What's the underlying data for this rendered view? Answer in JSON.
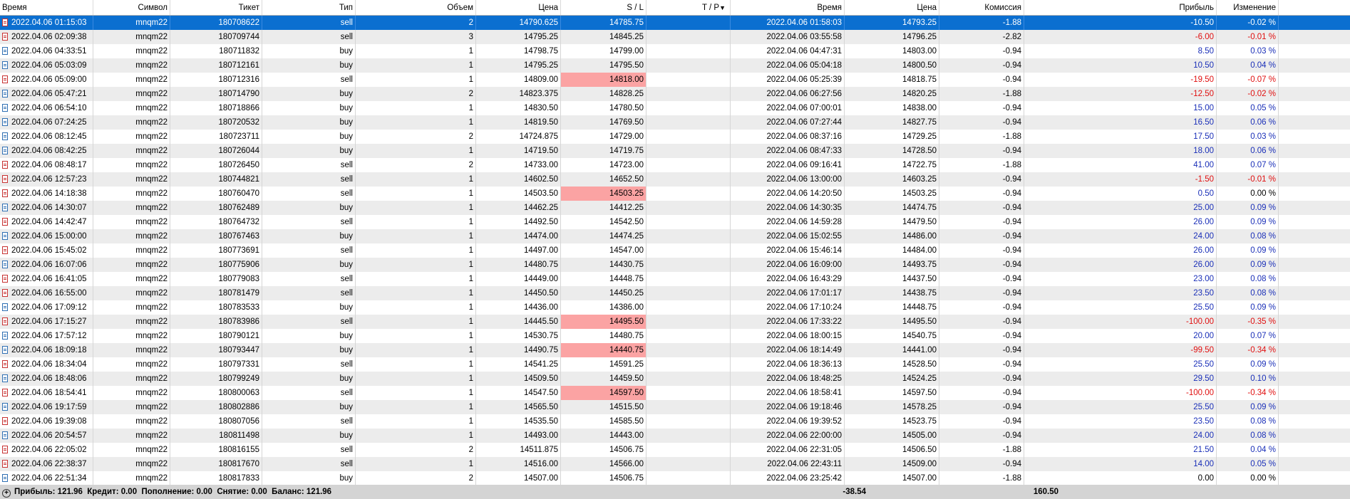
{
  "columns": [
    "Время",
    "Символ",
    "Тикет",
    "Тип",
    "Объем",
    "Цена",
    "S / L",
    "T / P",
    "Время",
    "Цена",
    "Комиссия",
    "Прибыль",
    "Изменение"
  ],
  "sort_arrow": "▼",
  "selected_row": 0,
  "rows": [
    {
      "t1": "2022.04.06 01:15:03",
      "sym": "mnqm22",
      "ticket": "180708622",
      "type": "sell",
      "vol": "2",
      "price": "14790.625",
      "sl": "14785.75",
      "sl_hit": false,
      "tp": "",
      "t2": "2022.04.06 01:58:03",
      "price2": "14793.25",
      "comm": "-1.88",
      "profit": "-10.50",
      "change": "-0.02 %"
    },
    {
      "t1": "2022.04.06 02:09:38",
      "sym": "mnqm22",
      "ticket": "180709744",
      "type": "sell",
      "vol": "3",
      "price": "14795.25",
      "sl": "14845.25",
      "sl_hit": false,
      "tp": "",
      "t2": "2022.04.06 03:55:58",
      "price2": "14796.25",
      "comm": "-2.82",
      "profit": "-6.00",
      "change": "-0.01 %"
    },
    {
      "t1": "2022.04.06 04:33:51",
      "sym": "mnqm22",
      "ticket": "180711832",
      "type": "buy",
      "vol": "1",
      "price": "14798.75",
      "sl": "14799.00",
      "sl_hit": false,
      "tp": "",
      "t2": "2022.04.06 04:47:31",
      "price2": "14803.00",
      "comm": "-0.94",
      "profit": "8.50",
      "change": "0.03 %"
    },
    {
      "t1": "2022.04.06 05:03:09",
      "sym": "mnqm22",
      "ticket": "180712161",
      "type": "buy",
      "vol": "1",
      "price": "14795.25",
      "sl": "14795.50",
      "sl_hit": false,
      "tp": "",
      "t2": "2022.04.06 05:04:18",
      "price2": "14800.50",
      "comm": "-0.94",
      "profit": "10.50",
      "change": "0.04 %"
    },
    {
      "t1": "2022.04.06 05:09:00",
      "sym": "mnqm22",
      "ticket": "180712316",
      "type": "sell",
      "vol": "1",
      "price": "14809.00",
      "sl": "14818.00",
      "sl_hit": true,
      "tp": "",
      "t2": "2022.04.06 05:25:39",
      "price2": "14818.75",
      "comm": "-0.94",
      "profit": "-19.50",
      "change": "-0.07 %"
    },
    {
      "t1": "2022.04.06 05:47:21",
      "sym": "mnqm22",
      "ticket": "180714790",
      "type": "buy",
      "vol": "2",
      "price": "14823.375",
      "sl": "14828.25",
      "sl_hit": false,
      "tp": "",
      "t2": "2022.04.06 06:27:56",
      "price2": "14820.25",
      "comm": "-1.88",
      "profit": "-12.50",
      "change": "-0.02 %"
    },
    {
      "t1": "2022.04.06 06:54:10",
      "sym": "mnqm22",
      "ticket": "180718866",
      "type": "buy",
      "vol": "1",
      "price": "14830.50",
      "sl": "14780.50",
      "sl_hit": false,
      "tp": "",
      "t2": "2022.04.06 07:00:01",
      "price2": "14838.00",
      "comm": "-0.94",
      "profit": "15.00",
      "change": "0.05 %"
    },
    {
      "t1": "2022.04.06 07:24:25",
      "sym": "mnqm22",
      "ticket": "180720532",
      "type": "buy",
      "vol": "1",
      "price": "14819.50",
      "sl": "14769.50",
      "sl_hit": false,
      "tp": "",
      "t2": "2022.04.06 07:27:44",
      "price2": "14827.75",
      "comm": "-0.94",
      "profit": "16.50",
      "change": "0.06 %"
    },
    {
      "t1": "2022.04.06 08:12:45",
      "sym": "mnqm22",
      "ticket": "180723711",
      "type": "buy",
      "vol": "2",
      "price": "14724.875",
      "sl": "14729.00",
      "sl_hit": false,
      "tp": "",
      "t2": "2022.04.06 08:37:16",
      "price2": "14729.25",
      "comm": "-1.88",
      "profit": "17.50",
      "change": "0.03 %"
    },
    {
      "t1": "2022.04.06 08:42:25",
      "sym": "mnqm22",
      "ticket": "180726044",
      "type": "buy",
      "vol": "1",
      "price": "14719.50",
      "sl": "14719.75",
      "sl_hit": false,
      "tp": "",
      "t2": "2022.04.06 08:47:33",
      "price2": "14728.50",
      "comm": "-0.94",
      "profit": "18.00",
      "change": "0.06 %"
    },
    {
      "t1": "2022.04.06 08:48:17",
      "sym": "mnqm22",
      "ticket": "180726450",
      "type": "sell",
      "vol": "2",
      "price": "14733.00",
      "sl": "14723.00",
      "sl_hit": false,
      "tp": "",
      "t2": "2022.04.06 09:16:41",
      "price2": "14722.75",
      "comm": "-1.88",
      "profit": "41.00",
      "change": "0.07 %"
    },
    {
      "t1": "2022.04.06 12:57:23",
      "sym": "mnqm22",
      "ticket": "180744821",
      "type": "sell",
      "vol": "1",
      "price": "14602.50",
      "sl": "14652.50",
      "sl_hit": false,
      "tp": "",
      "t2": "2022.04.06 13:00:00",
      "price2": "14603.25",
      "comm": "-0.94",
      "profit": "-1.50",
      "change": "-0.01 %"
    },
    {
      "t1": "2022.04.06 14:18:38",
      "sym": "mnqm22",
      "ticket": "180760470",
      "type": "sell",
      "vol": "1",
      "price": "14503.50",
      "sl": "14503.25",
      "sl_hit": true,
      "tp": "",
      "t2": "2022.04.06 14:20:50",
      "price2": "14503.25",
      "comm": "-0.94",
      "profit": "0.50",
      "change": "0.00 %"
    },
    {
      "t1": "2022.04.06 14:30:07",
      "sym": "mnqm22",
      "ticket": "180762489",
      "type": "buy",
      "vol": "1",
      "price": "14462.25",
      "sl": "14412.25",
      "sl_hit": false,
      "tp": "",
      "t2": "2022.04.06 14:30:35",
      "price2": "14474.75",
      "comm": "-0.94",
      "profit": "25.00",
      "change": "0.09 %"
    },
    {
      "t1": "2022.04.06 14:42:47",
      "sym": "mnqm22",
      "ticket": "180764732",
      "type": "sell",
      "vol": "1",
      "price": "14492.50",
      "sl": "14542.50",
      "sl_hit": false,
      "tp": "",
      "t2": "2022.04.06 14:59:28",
      "price2": "14479.50",
      "comm": "-0.94",
      "profit": "26.00",
      "change": "0.09 %"
    },
    {
      "t1": "2022.04.06 15:00:00",
      "sym": "mnqm22",
      "ticket": "180767463",
      "type": "buy",
      "vol": "1",
      "price": "14474.00",
      "sl": "14474.25",
      "sl_hit": false,
      "tp": "",
      "t2": "2022.04.06 15:02:55",
      "price2": "14486.00",
      "comm": "-0.94",
      "profit": "24.00",
      "change": "0.08 %"
    },
    {
      "t1": "2022.04.06 15:45:02",
      "sym": "mnqm22",
      "ticket": "180773691",
      "type": "sell",
      "vol": "1",
      "price": "14497.00",
      "sl": "14547.00",
      "sl_hit": false,
      "tp": "",
      "t2": "2022.04.06 15:46:14",
      "price2": "14484.00",
      "comm": "-0.94",
      "profit": "26.00",
      "change": "0.09 %"
    },
    {
      "t1": "2022.04.06 16:07:06",
      "sym": "mnqm22",
      "ticket": "180775906",
      "type": "buy",
      "vol": "1",
      "price": "14480.75",
      "sl": "14430.75",
      "sl_hit": false,
      "tp": "",
      "t2": "2022.04.06 16:09:00",
      "price2": "14493.75",
      "comm": "-0.94",
      "profit": "26.00",
      "change": "0.09 %"
    },
    {
      "t1": "2022.04.06 16:41:05",
      "sym": "mnqm22",
      "ticket": "180779083",
      "type": "sell",
      "vol": "1",
      "price": "14449.00",
      "sl": "14448.75",
      "sl_hit": false,
      "tp": "",
      "t2": "2022.04.06 16:43:29",
      "price2": "14437.50",
      "comm": "-0.94",
      "profit": "23.00",
      "change": "0.08 %"
    },
    {
      "t1": "2022.04.06 16:55:00",
      "sym": "mnqm22",
      "ticket": "180781479",
      "type": "sell",
      "vol": "1",
      "price": "14450.50",
      "sl": "14450.25",
      "sl_hit": false,
      "tp": "",
      "t2": "2022.04.06 17:01:17",
      "price2": "14438.75",
      "comm": "-0.94",
      "profit": "23.50",
      "change": "0.08 %"
    },
    {
      "t1": "2022.04.06 17:09:12",
      "sym": "mnqm22",
      "ticket": "180783533",
      "type": "buy",
      "vol": "1",
      "price": "14436.00",
      "sl": "14386.00",
      "sl_hit": false,
      "tp": "",
      "t2": "2022.04.06 17:10:24",
      "price2": "14448.75",
      "comm": "-0.94",
      "profit": "25.50",
      "change": "0.09 %"
    },
    {
      "t1": "2022.04.06 17:15:27",
      "sym": "mnqm22",
      "ticket": "180783986",
      "type": "sell",
      "vol": "1",
      "price": "14445.50",
      "sl": "14495.50",
      "sl_hit": true,
      "tp": "",
      "t2": "2022.04.06 17:33:22",
      "price2": "14495.50",
      "comm": "-0.94",
      "profit": "-100.00",
      "change": "-0.35 %"
    },
    {
      "t1": "2022.04.06 17:57:12",
      "sym": "mnqm22",
      "ticket": "180790121",
      "type": "buy",
      "vol": "1",
      "price": "14530.75",
      "sl": "14480.75",
      "sl_hit": false,
      "tp": "",
      "t2": "2022.04.06 18:00:15",
      "price2": "14540.75",
      "comm": "-0.94",
      "profit": "20.00",
      "change": "0.07 %"
    },
    {
      "t1": "2022.04.06 18:09:18",
      "sym": "mnqm22",
      "ticket": "180793447",
      "type": "buy",
      "vol": "1",
      "price": "14490.75",
      "sl": "14440.75",
      "sl_hit": true,
      "tp": "",
      "t2": "2022.04.06 18:14:49",
      "price2": "14441.00",
      "comm": "-0.94",
      "profit": "-99.50",
      "change": "-0.34 %"
    },
    {
      "t1": "2022.04.06 18:34:04",
      "sym": "mnqm22",
      "ticket": "180797331",
      "type": "sell",
      "vol": "1",
      "price": "14541.25",
      "sl": "14591.25",
      "sl_hit": false,
      "tp": "",
      "t2": "2022.04.06 18:36:13",
      "price2": "14528.50",
      "comm": "-0.94",
      "profit": "25.50",
      "change": "0.09 %"
    },
    {
      "t1": "2022.04.06 18:48:06",
      "sym": "mnqm22",
      "ticket": "180799249",
      "type": "buy",
      "vol": "1",
      "price": "14509.50",
      "sl": "14459.50",
      "sl_hit": false,
      "tp": "",
      "t2": "2022.04.06 18:48:25",
      "price2": "14524.25",
      "comm": "-0.94",
      "profit": "29.50",
      "change": "0.10 %"
    },
    {
      "t1": "2022.04.06 18:54:41",
      "sym": "mnqm22",
      "ticket": "180800063",
      "type": "sell",
      "vol": "1",
      "price": "14547.50",
      "sl": "14597.50",
      "sl_hit": true,
      "tp": "",
      "t2": "2022.04.06 18:58:41",
      "price2": "14597.50",
      "comm": "-0.94",
      "profit": "-100.00",
      "change": "-0.34 %"
    },
    {
      "t1": "2022.04.06 19:17:59",
      "sym": "mnqm22",
      "ticket": "180802886",
      "type": "buy",
      "vol": "1",
      "price": "14565.50",
      "sl": "14515.50",
      "sl_hit": false,
      "tp": "",
      "t2": "2022.04.06 19:18:46",
      "price2": "14578.25",
      "comm": "-0.94",
      "profit": "25.50",
      "change": "0.09 %"
    },
    {
      "t1": "2022.04.06 19:39:08",
      "sym": "mnqm22",
      "ticket": "180807056",
      "type": "sell",
      "vol": "1",
      "price": "14535.50",
      "sl": "14585.50",
      "sl_hit": false,
      "tp": "",
      "t2": "2022.04.06 19:39:52",
      "price2": "14523.75",
      "comm": "-0.94",
      "profit": "23.50",
      "change": "0.08 %"
    },
    {
      "t1": "2022.04.06 20:54:57",
      "sym": "mnqm22",
      "ticket": "180811498",
      "type": "buy",
      "vol": "1",
      "price": "14493.00",
      "sl": "14443.00",
      "sl_hit": false,
      "tp": "",
      "t2": "2022.04.06 22:00:00",
      "price2": "14505.00",
      "comm": "-0.94",
      "profit": "24.00",
      "change": "0.08 %"
    },
    {
      "t1": "2022.04.06 22:05:02",
      "sym": "mnqm22",
      "ticket": "180816155",
      "type": "sell",
      "vol": "2",
      "price": "14511.875",
      "sl": "14506.75",
      "sl_hit": false,
      "tp": "",
      "t2": "2022.04.06 22:31:05",
      "price2": "14506.50",
      "comm": "-1.88",
      "profit": "21.50",
      "change": "0.04 %"
    },
    {
      "t1": "2022.04.06 22:38:37",
      "sym": "mnqm22",
      "ticket": "180817670",
      "type": "sell",
      "vol": "1",
      "price": "14516.00",
      "sl": "14566.00",
      "sl_hit": false,
      "tp": "",
      "t2": "2022.04.06 22:43:11",
      "price2": "14509.00",
      "comm": "-0.94",
      "profit": "14.00",
      "change": "0.05 %"
    },
    {
      "t1": "2022.04.06 22:51:34",
      "sym": "mnqm22",
      "ticket": "180817833",
      "type": "buy",
      "vol": "2",
      "price": "14507.00",
      "sl": "14506.75",
      "sl_hit": false,
      "tp": "",
      "t2": "2022.04.06 23:25:42",
      "price2": "14507.00",
      "comm": "-1.88",
      "profit": "0.00",
      "change": "0.00 %"
    }
  ],
  "footer": {
    "expand_icon": "⊕",
    "summary": "Прибыль: 121.96  Кредит: 0.00  Пополнение: 0.00  Снятие: 0.00  Баланс: 121.96",
    "commission_total": "-38.54",
    "profit_total": "160.50"
  },
  "colors": {
    "selected_row": "#0b6fd0",
    "stop_loss_hit": "#fba3a3",
    "positive": "#1a2fb8",
    "negative": "#e01010",
    "alt_row": "#ececec"
  }
}
